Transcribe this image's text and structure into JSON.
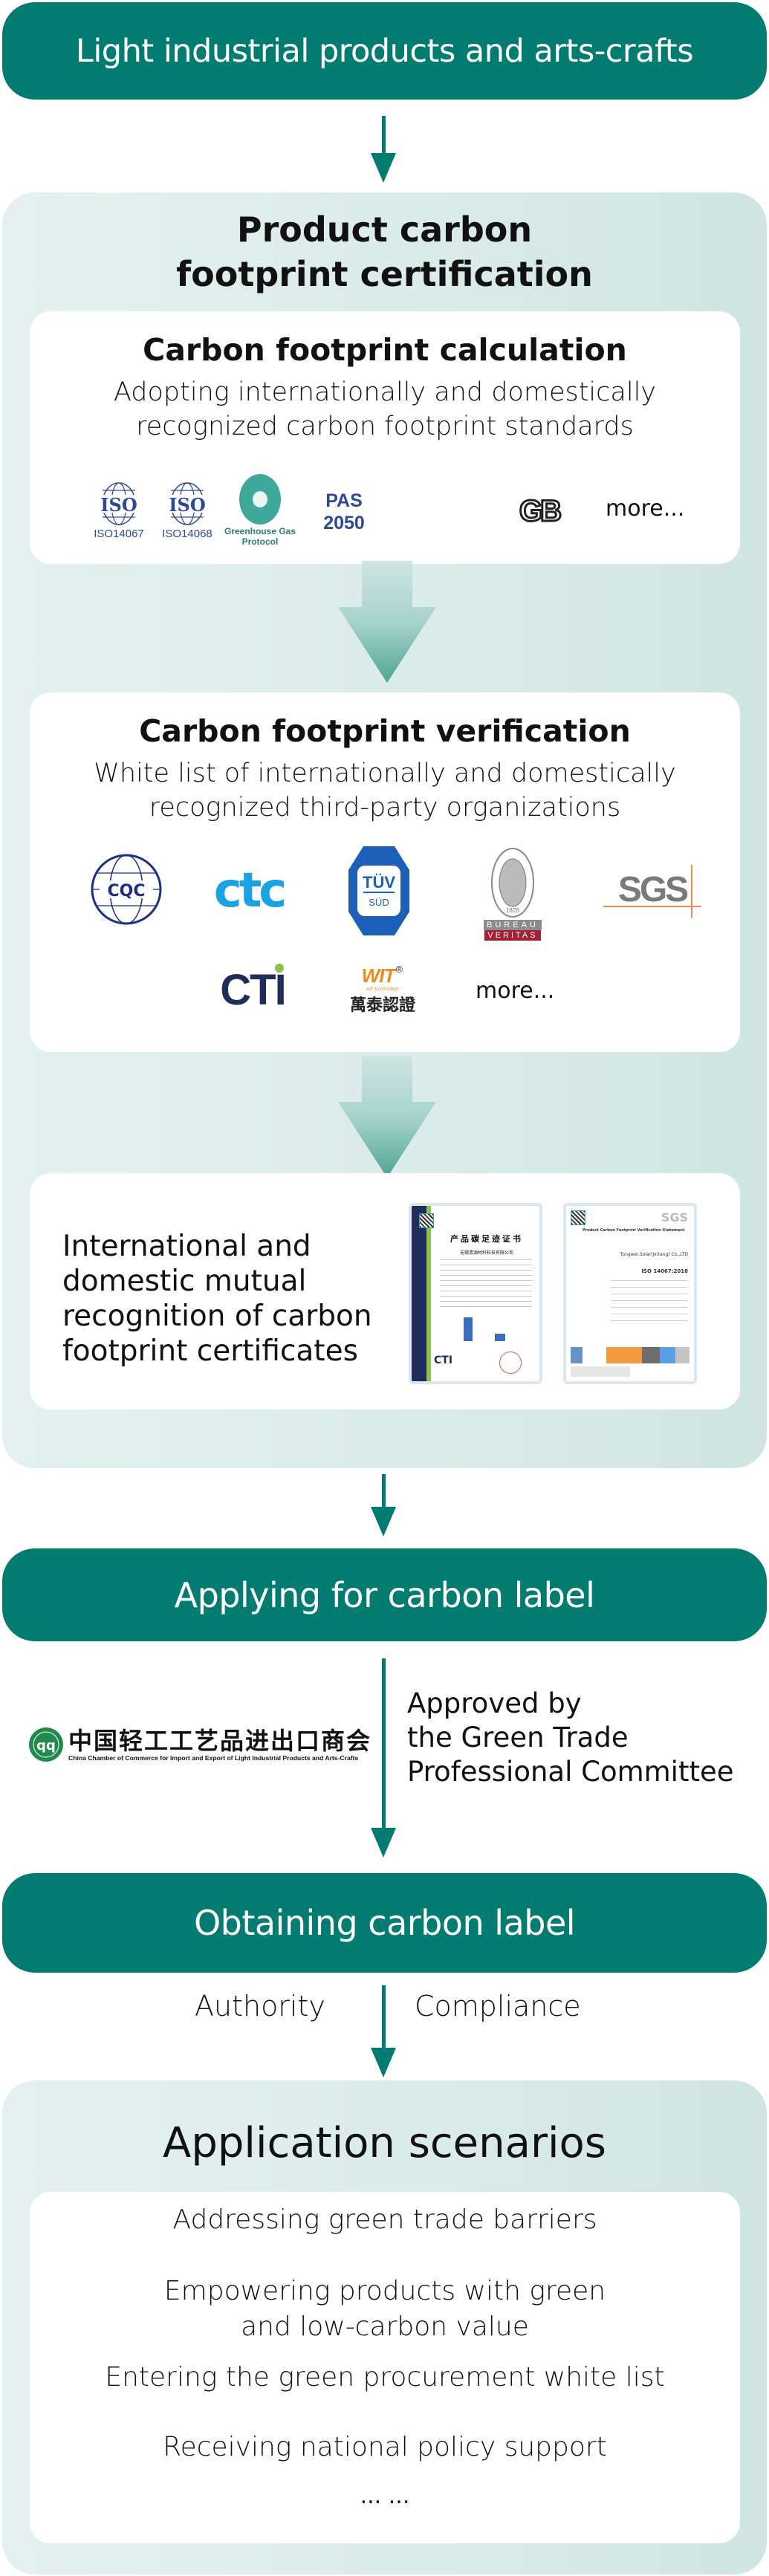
{
  "colors": {
    "primary": "#027c70",
    "panel_bg": "#dcecea",
    "card_bg": "#ffffff",
    "text": "#111111",
    "iso_blue": "#2e4a96",
    "ghg_teal": "#3ea89a",
    "cqc_blue": "#1a2f8a",
    "ctc_blue": "#1aa3e2",
    "tuv_blue": "#1c5fb8",
    "bv_red": "#a32035",
    "sgs_gray": "#7a7a7a",
    "cti_navy": "#1f2d5a",
    "wit_orange": "#f08a1e",
    "chamber_green": "#1f8a4c"
  },
  "step1": {
    "label": "Light industrial products and arts-crafts"
  },
  "certification": {
    "title_line1": "Product carbon",
    "title_line2": "footprint certification",
    "calculation": {
      "title": "Carbon footprint calculation",
      "desc_line1": "Adopting internationally and domestically",
      "desc_line2": "recognized carbon footprint standards",
      "logos": [
        {
          "icon": "iso-logo",
          "mark": "ISO",
          "caption": "ISO14067"
        },
        {
          "icon": "iso-logo",
          "mark": "ISO",
          "caption": "ISO14068"
        },
        {
          "icon": "ghg-protocol-logo",
          "caption_line1": "Greenhouse Gas",
          "caption_line2": "Protocol"
        },
        {
          "icon": "pas-logo",
          "line1": "PAS",
          "line2": "2050"
        },
        {
          "icon": "gb-logo",
          "mark": "GB"
        }
      ],
      "more": "more..."
    },
    "verification": {
      "title": "Carbon footprint verification",
      "desc_line1": "White list of internationally and domestically",
      "desc_line2": "recognized third-party organizations",
      "logos": [
        {
          "icon": "cqc-logo",
          "mark": "CQC"
        },
        {
          "icon": "ctc-logo",
          "mark": "ctc"
        },
        {
          "icon": "tuv-sud-logo",
          "line1": "TÜV",
          "line2": "SÜD"
        },
        {
          "icon": "bureau-veritas-logo",
          "line1": "BUREAU",
          "line2": "VERITAS",
          "year": "1828"
        },
        {
          "icon": "sgs-logo",
          "mark": "SGS"
        },
        {
          "icon": "cti-logo",
          "mark": "CTI"
        },
        {
          "icon": "wit-logo",
          "mark": "WIT",
          "sub": "WIT ASSESSMENT",
          "cn": "萬泰認證",
          "reg": "®"
        }
      ],
      "more": "more..."
    },
    "recognition": {
      "text_line1": "International and",
      "text_line2": "domestic mutual",
      "text_line3": "recognition of carbon",
      "text_line4": "footprint certificates",
      "cert_cti": {
        "title_cn": "产品碳足迹证书",
        "company_cn": "无锡清源材料科技有限公司",
        "brand": "CTI"
      },
      "cert_sgs": {
        "heading": "Product Carbon Footprint Verification Statement",
        "company": "Tongwei Solar(Jintang) Co.,LTD",
        "standard": "ISO 14067:2018",
        "brand": "SGS"
      }
    }
  },
  "step_apply": {
    "label": "Applying for carbon label"
  },
  "approval": {
    "chamber_cn": "中国轻工工艺品进出口商会",
    "chamber_en": "China Chamber of Commerce for Import and Export of Light Industrial Products and Arts-Crafts",
    "text_line1": "Approved by",
    "text_line2": "the Green Trade",
    "text_line3": "Professional Committee"
  },
  "step_obtain": {
    "label": "Obtaining carbon label"
  },
  "attributes": {
    "left": "Authority",
    "right": "Compliance"
  },
  "scenarios": {
    "title": "Application scenarios",
    "items": [
      {
        "line1": "Addressing green trade barriers"
      },
      {
        "line1": "Empowering products with green",
        "line2": "and low-carbon value"
      },
      {
        "line1": "Entering the green procurement white list"
      },
      {
        "line1": "Receiving national policy support"
      }
    ],
    "ellipsis": "... ..."
  }
}
